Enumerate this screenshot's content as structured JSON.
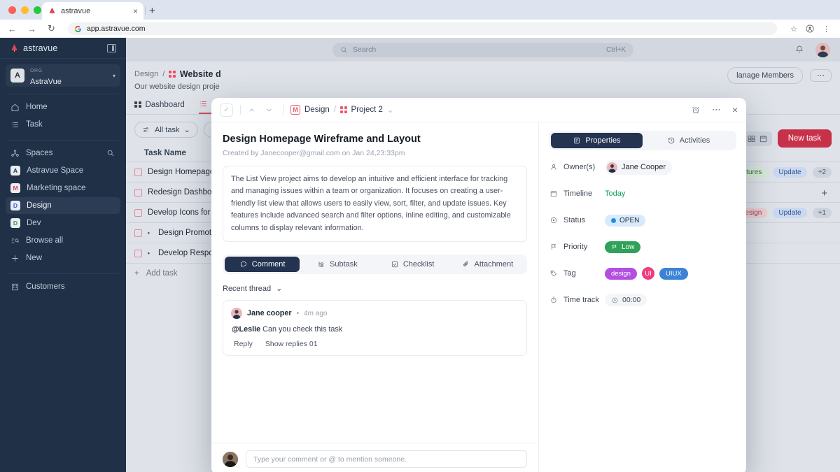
{
  "browser": {
    "tab_title": "astravue",
    "tab_close": "×",
    "new_tab": "+",
    "back": "←",
    "forward": "→",
    "reload": "↻",
    "url": "app.astravue.com",
    "star": "☆",
    "profile_icon": "profile-icon",
    "menu": "⋮"
  },
  "sidebar": {
    "brand": "astravue",
    "org_label": "ORG",
    "org_name": "AstraVue",
    "org_avatar": "A",
    "caret": "▾",
    "nav": [
      {
        "label": "Home",
        "icon": "home-icon"
      },
      {
        "label": "Task",
        "icon": "list-icon"
      }
    ],
    "spaces_label": "Spaces",
    "spaces": [
      {
        "label": "Astravue Space",
        "badge": "A",
        "color": "#1f3047"
      },
      {
        "label": "Marketing space",
        "badge": "M",
        "color": "#e0405a"
      },
      {
        "label": "Design",
        "badge": "D",
        "color": "#3b5bdb"
      },
      {
        "label": "Dev",
        "badge": "D",
        "color": "#2f9e44"
      }
    ],
    "browse_all": "Browse all",
    "new": "New",
    "customers": "Customers"
  },
  "topbar": {
    "search_placeholder": "Search",
    "search_shortcut": "Ctrl+K"
  },
  "page": {
    "breadcrumb_space": "Design",
    "breadcrumb_sep": "/",
    "breadcrumb_project": "Website d",
    "subtitle": "Our website design proje",
    "tabs": [
      {
        "label": "Dashboard",
        "active": false
      },
      {
        "label": "",
        "active": true
      }
    ],
    "filters": [
      {
        "label": "All task",
        "caret": "⌄"
      },
      {
        "label": "",
        "caret": ""
      }
    ],
    "new_task_label": "New task",
    "manage_members_label": "lanage Members",
    "more_dots": "⋯",
    "table_header": "Task Name",
    "rows": [
      {
        "name": "Design Homepage",
        "expand": false,
        "tags": [
          "atures",
          "Update"
        ],
        "extra": "+2"
      },
      {
        "name": "Redesign Dashboa",
        "expand": false,
        "tags": [],
        "extra": ""
      },
      {
        "name": "Develop Icons for",
        "expand": false,
        "tags": [
          "Design",
          "Update"
        ],
        "extra": "+1"
      },
      {
        "name": "Design Promotiona",
        "expand": true,
        "tags": [],
        "extra": ""
      },
      {
        "name": "Develop Responsiv",
        "expand": true,
        "tags": [],
        "extra": ""
      }
    ],
    "add_task": "Add task",
    "plus": "+"
  },
  "modal": {
    "header": {
      "check": "✓",
      "up": "⌃",
      "down": "⌄",
      "space_badge": "M",
      "space": "Design",
      "sep": "/",
      "project": "Project 2",
      "project_caret": "⌄",
      "reminder_icon": "alarm-clock-icon",
      "more_icon": "⋯",
      "close_icon": "×"
    },
    "title": "Design Homepage Wireframe and Layout",
    "meta": "Created by Janecooper@gmail.com on Jan 24,23:33pm",
    "description": "The List View project aims to develop an intuitive and efficient interface for tracking and managing issues within a team or organization. It focuses on creating a user-friendly list view that allows users to easily view, sort, filter, and update issues. Key features include advanced search and filter options, inline editing, and customizable columns to display relevant information.",
    "tabs": [
      {
        "label": "Comment",
        "icon": "comment-icon",
        "active": true
      },
      {
        "label": "Subtask",
        "icon": "subtask-icon",
        "active": false
      },
      {
        "label": "Checklist",
        "icon": "checklist-icon",
        "active": false
      },
      {
        "label": "Attachment",
        "icon": "attachment-icon",
        "active": false
      }
    ],
    "thread_label": "Recent thread",
    "thread_caret": "⌄",
    "comment": {
      "author": "Jane cooper",
      "dot": "•",
      "time": "4m ago",
      "mention": "@Leslie",
      "text": " Can you check this task",
      "reply": "Reply",
      "show_replies": "Show replies 01"
    },
    "composer_placeholder": "Type your comment or @ to mention someone."
  },
  "properties": {
    "tabs": [
      {
        "label": "Properties",
        "icon": "properties-icon",
        "active": true
      },
      {
        "label": "Activities",
        "icon": "history-icon",
        "active": false
      }
    ],
    "rows": {
      "owner_label": "Owner(s)",
      "owner_value": "Jane Cooper",
      "timeline_label": "Timeline",
      "timeline_value": "Today",
      "status_label": "Status",
      "status_value": "OPEN",
      "priority_label": "Priority",
      "priority_value": "Low",
      "tag_label": "Tag",
      "tags": [
        "design",
        "UI",
        "UIUX"
      ],
      "time_label": "Time track",
      "time_value": "00:00"
    }
  },
  "colors": {
    "accent_red": "#c8314a",
    "navy": "#233350",
    "status_blue": "#1d8ef2",
    "priority_green": "#2fa158",
    "timeline_green": "#12a05c",
    "tag_purple": "#b24fe0",
    "tag_pink": "#ef3e7e",
    "tag_blue": "#3c82d6"
  }
}
